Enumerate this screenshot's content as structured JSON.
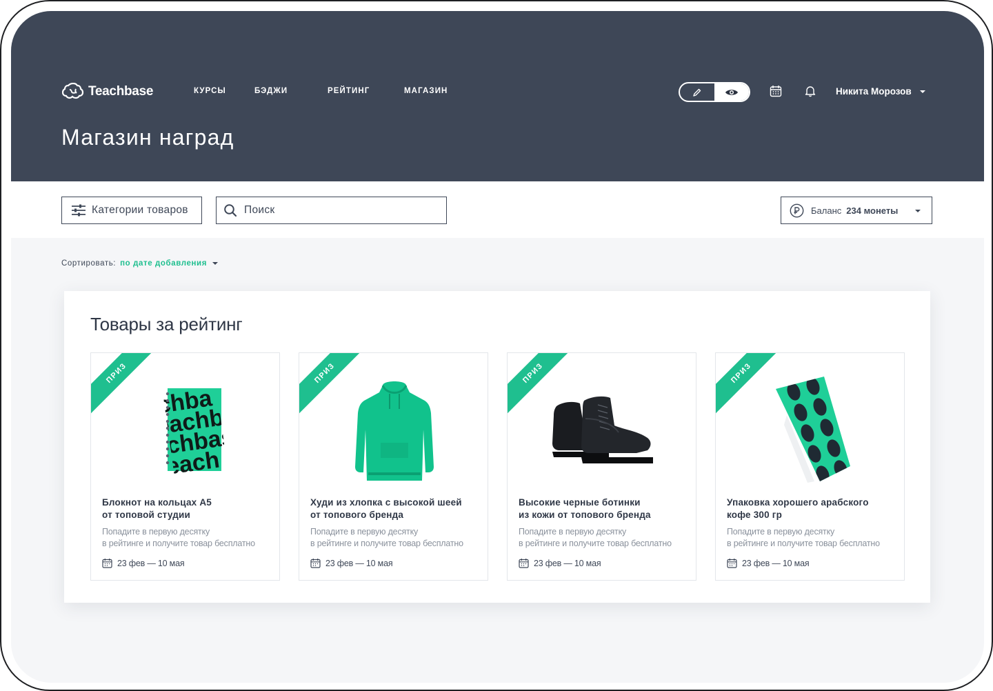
{
  "app": {
    "logo_text": "Teachbase",
    "page_title": "Магазин наград"
  },
  "nav": [
    {
      "label": "КУРСЫ"
    },
    {
      "label": "БЭДЖИ"
    },
    {
      "label": "РЕЙТИНГ"
    },
    {
      "label": "МАГАЗИН"
    }
  ],
  "header": {
    "user_name": "Никита Морозов",
    "icons": [
      "pencil-icon",
      "eye-icon",
      "calendar-icon",
      "bell-icon",
      "chevron-down-icon"
    ]
  },
  "toolbar": {
    "categories_label": "Категории товаров",
    "search_placeholder": "Поиск",
    "search_value": "",
    "balance_label": "Баланс",
    "balance_amount": "234 монеты"
  },
  "sort": {
    "label": "Сортировать:",
    "value": "по дате добавления"
  },
  "section": {
    "title": "Товары за рейтинг"
  },
  "products": [
    {
      "badge": "ПРИЗ",
      "image": "notebook",
      "title_line1": "Блокнот на кольцах А5",
      "title_line2": "от топовой студии",
      "desc_line1": "Попадите в первую десятку",
      "desc_line2": "в рейтинге и получите товар бесплатно",
      "dates": "23 фев — 10 мая"
    },
    {
      "badge": "ПРИЗ",
      "image": "hoodie",
      "title_line1": "Худи из хлопка с высокой шеей",
      "title_line2": "от топового бренда",
      "desc_line1": "Попадите в первую десятку",
      "desc_line2": "в рейтинге и получите товар бесплатно",
      "dates": "23 фев — 10 мая"
    },
    {
      "badge": "ПРИЗ",
      "image": "boots",
      "title_line1": "Высокие черные ботинки",
      "title_line2": "из кожи от топового бренда",
      "desc_line1": "Попадите в первую десятку",
      "desc_line2": "в рейтинге и получите товар бесплатно",
      "dates": "23 фев — 10 мая"
    },
    {
      "badge": "ПРИЗ",
      "image": "coffee-pack",
      "title_line1": "Упаковка хорошего арабского",
      "title_line2": "кофе 300 гр",
      "desc_line1": "Попадите в первую десятку",
      "desc_line2": "в рейтинге и получите товар бесплатно",
      "dates": "23 фев — 10 мая"
    }
  ],
  "colors": {
    "header_bg": "#3e4757",
    "accent": "#1fbf8f",
    "page_bg": "#f5f6f8",
    "text_dark": "#2f3746",
    "text_muted": "#8a919c"
  }
}
